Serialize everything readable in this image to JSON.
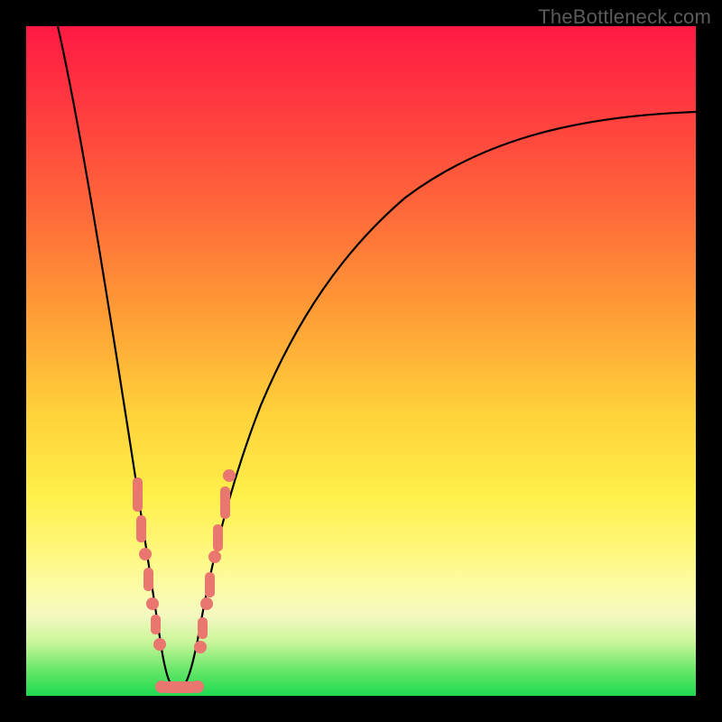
{
  "watermark": "TheBottleneck.com",
  "colors": {
    "frame": "#000000",
    "gradient_top": "#ff1a44",
    "gradient_bottom": "#1ed94f",
    "curve": "#000000",
    "marker": "#e9766f"
  },
  "chart_data": {
    "type": "line",
    "title": "",
    "xlabel": "",
    "ylabel": "",
    "xlim": [
      0,
      100
    ],
    "ylim": [
      0,
      100
    ],
    "grid": false,
    "legend": false,
    "notes": "No axis ticks or numeric labels are rendered; curve depicts a V-shaped bottleneck function with minimum near x≈20. Values are estimated heights of the black curve as percent of plot height (0 = bottom green, 100 = top red).",
    "series": [
      {
        "name": "bottleneck-curve",
        "x": [
          0,
          2,
          4,
          6,
          8,
          10,
          12,
          14,
          16,
          18,
          20,
          22,
          24,
          26,
          28,
          30,
          34,
          38,
          42,
          48,
          55,
          62,
          70,
          78,
          86,
          94,
          100
        ],
        "y": [
          100,
          90,
          80,
          69,
          58,
          47,
          37,
          27,
          18,
          9,
          1,
          1,
          6,
          13,
          21,
          29,
          40,
          48,
          54,
          61,
          67,
          72,
          77,
          80,
          83,
          85,
          86
        ]
      }
    ],
    "markers": {
      "left_cluster": {
        "x_range": [
          12,
          18
        ],
        "y_range": [
          11,
          32
        ]
      },
      "right_cluster": {
        "x_range": [
          24,
          30
        ],
        "y_range": [
          11,
          32
        ]
      },
      "bottom_bar": {
        "x_range": [
          18,
          24
        ],
        "y_approx": 1
      }
    }
  }
}
